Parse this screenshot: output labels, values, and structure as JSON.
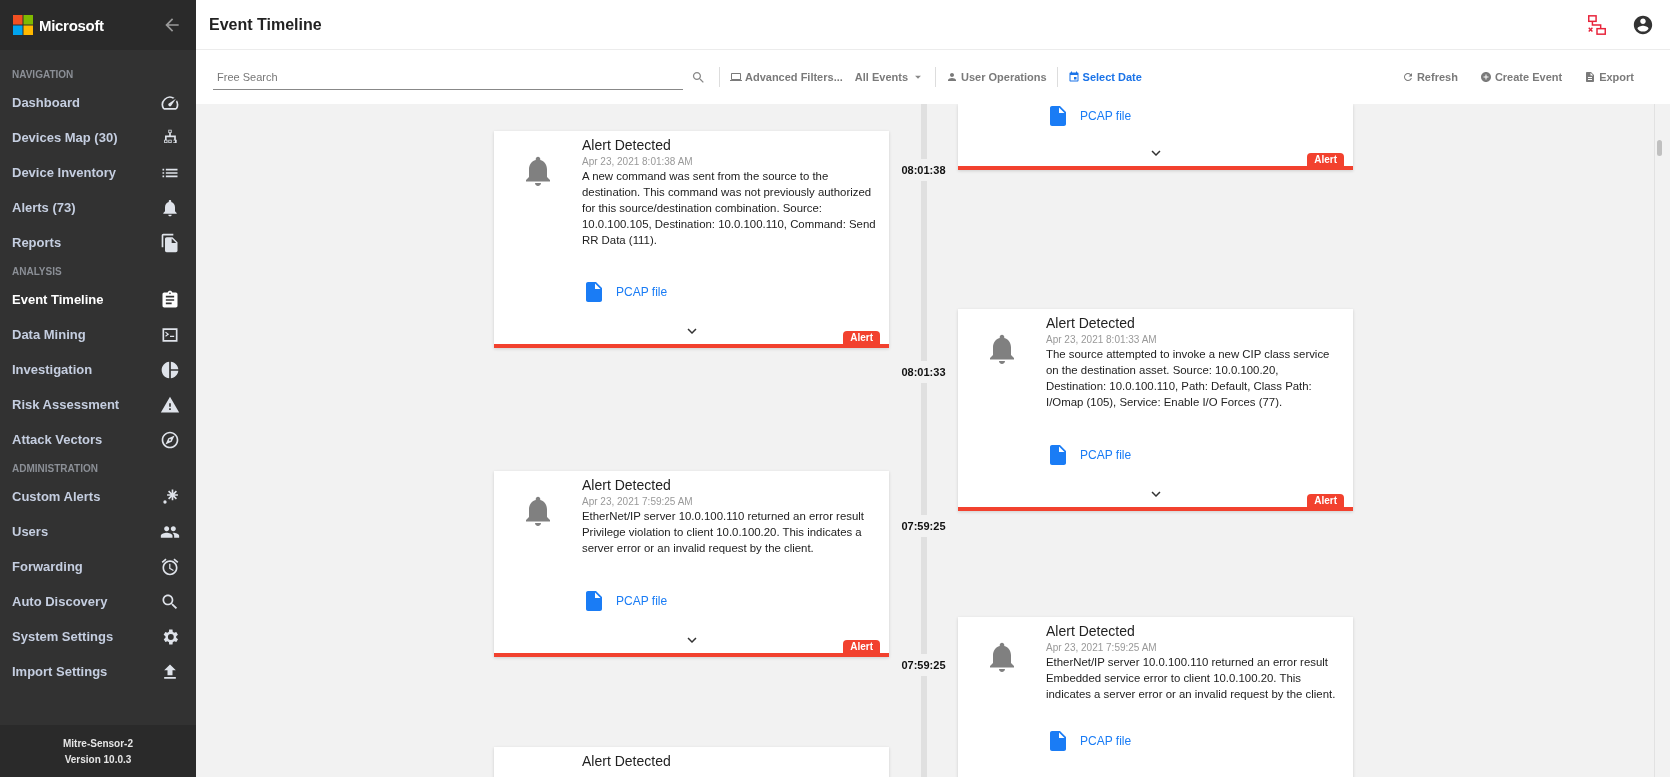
{
  "sidebar": {
    "brand": "Microsoft",
    "sections": [
      {
        "heading": "NAVIGATION",
        "items": [
          {
            "label": "Dashboard",
            "selected": false
          },
          {
            "label": "Devices Map (30)",
            "selected": false
          },
          {
            "label": "Device Inventory",
            "selected": false
          },
          {
            "label": "Alerts (73)",
            "selected": false
          },
          {
            "label": "Reports",
            "selected": false
          }
        ]
      },
      {
        "heading": "ANALYSIS",
        "items": [
          {
            "label": "Event Timeline",
            "selected": true
          },
          {
            "label": "Data Mining",
            "selected": false
          },
          {
            "label": "Investigation",
            "selected": false
          },
          {
            "label": "Risk Assessment",
            "selected": false
          },
          {
            "label": "Attack Vectors",
            "selected": false
          }
        ]
      },
      {
        "heading": "ADMINISTRATION",
        "items": [
          {
            "label": "Custom Alerts",
            "selected": false
          },
          {
            "label": "Users",
            "selected": false
          },
          {
            "label": "Forwarding",
            "selected": false
          },
          {
            "label": "Auto Discovery",
            "selected": false
          },
          {
            "label": "System Settings",
            "selected": false
          },
          {
            "label": "Import Settings",
            "selected": false
          }
        ]
      }
    ],
    "footer": [
      "Mitre-Sensor-2",
      "Version 10.0.3"
    ]
  },
  "header": {
    "title": "Event Timeline"
  },
  "toolbar": {
    "search": {
      "placeholder": "Free Search"
    },
    "filters": [
      {
        "label": "Advanced Filters...",
        "kind": "button",
        "selected": false
      },
      {
        "label": "All Events",
        "kind": "dropdown",
        "selected": false
      },
      {
        "label": "User Operations",
        "kind": "button",
        "selected": false
      },
      {
        "label": "Select Date",
        "kind": "button",
        "selected": true
      }
    ],
    "actions": [
      "Refresh",
      "Create Event",
      "Export"
    ]
  },
  "timeline": {
    "left": [
      {
        "title": "Alert Detected",
        "date": "Apr 23, 2021 8:01:38 AM",
        "text": "A new command was sent from the source to the destination. This command was not previously authorized for this source/destination combination. Source: 10.0.100.105, Destination: 10.0.100.110, Command: Send RR Data (111).",
        "attachment": "PCAP file",
        "tag": "Alert"
      },
      {
        "title": "Alert Detected",
        "date": "Apr 23, 2021 7:59:25 AM",
        "text": "EtherNet/IP server 10.0.100.110 returned an error result Privilege violation to client 10.0.100.20. This indicates a server error or an invalid request by the client.",
        "attachment": "PCAP file",
        "tag": "Alert"
      },
      {
        "title": "Alert Detected"
      }
    ],
    "right": [
      {
        "attachment": "PCAP file",
        "tag": "Alert"
      },
      {
        "title": "Alert Detected",
        "date": "Apr 23, 2021 8:01:33 AM",
        "text": "The source attempted to invoke a new CIP class service on the destination asset. Source: 10.0.100.20, Destination: 10.0.100.110, Path: Default, Class Path: I/Omap (105), Service: Enable I/O Forces (77).",
        "attachment": "PCAP file",
        "tag": "Alert"
      },
      {
        "title": "Alert Detected",
        "date": "Apr 23, 2021 7:59:25 AM",
        "text": "EtherNet/IP server 10.0.100.110 returned an error result Embedded service error to client 10.0.100.20. This indicates a server error or an invalid request by the client.",
        "attachment": "PCAP file"
      }
    ],
    "times": [
      "08:01:38",
      "08:01:33",
      "07:59:25",
      "07:59:25"
    ]
  }
}
